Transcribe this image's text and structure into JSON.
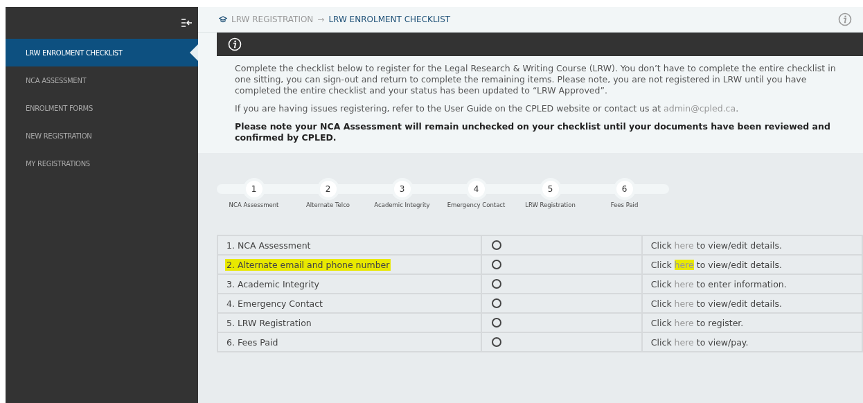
{
  "sidebar": {
    "items": [
      {
        "label": "LRW ENROLMENT CHECKLIST",
        "selected": true
      },
      {
        "label": "NCA ASSESSMENT",
        "selected": false
      },
      {
        "label": "ENROLMENT FORMS",
        "selected": false
      },
      {
        "label": "NEW REGISTRATION",
        "selected": false
      },
      {
        "label": "MY REGISTRATIONS",
        "selected": false
      }
    ]
  },
  "breadcrumb": {
    "items": [
      "LRW REGISTRATION",
      "LRW ENROLMENT CHECKLIST"
    ],
    "separator": "→"
  },
  "intro": {
    "paragraph_1": "Complete the checklist below to register for the Legal Research & Writing Course (LRW). You don’t have to complete the entire checklist in one sitting, you can sign-out and return to complete the remaining items. Please note, you are not registered in LRW until you have completed the entire checklist and your status has been updated to “LRW Approved”.",
    "paragraph_2": {
      "text": "If you are having issues registering, refer to the User Guide on the CPLED website or contact us at ",
      "link": "admin@cpled.ca",
      "end": "."
    },
    "note": "Please note your NCA Assessment will remain unchecked on your checklist until your documents have been reviewed and confirmed by CPLED."
  },
  "steps": [
    {
      "number": "1",
      "label": "NCA Assessment"
    },
    {
      "number": "2",
      "label": "Alternate Telco"
    },
    {
      "number": "3",
      "label": "Academic Integrity"
    },
    {
      "number": "4",
      "label": "Emergency Contact"
    },
    {
      "number": "5",
      "label": "LRW Registration"
    },
    {
      "number": "6",
      "label": "Fees Paid"
    }
  ],
  "checklist": [
    {
      "item": "1. NCA Assessment",
      "checked": false,
      "highlighted": false,
      "action": {
        "before": "Click ",
        "link": "here",
        "after": " to view/edit details."
      }
    },
    {
      "item": "2. Alternate email and phone number",
      "checked": false,
      "highlighted": true,
      "action": {
        "before": "Click ",
        "link": "here",
        "after": " to view/edit details."
      }
    },
    {
      "item": "3. Academic Integrity",
      "checked": false,
      "highlighted": false,
      "action": {
        "before": "Click ",
        "link": "here",
        "after": " to enter information."
      }
    },
    {
      "item": "4. Emergency Contact",
      "checked": false,
      "highlighted": false,
      "action": {
        "before": "Click ",
        "link": "here",
        "after": " to view/edit details."
      }
    },
    {
      "item": "5. LRW Registration",
      "checked": false,
      "highlighted": false,
      "action": {
        "before": "Click ",
        "link": "here",
        "after": " to register."
      }
    },
    {
      "item": "6. Fees Paid",
      "checked": false,
      "highlighted": false,
      "action": {
        "before": "Click ",
        "link": "here",
        "after": " to view/pay."
      }
    }
  ]
}
